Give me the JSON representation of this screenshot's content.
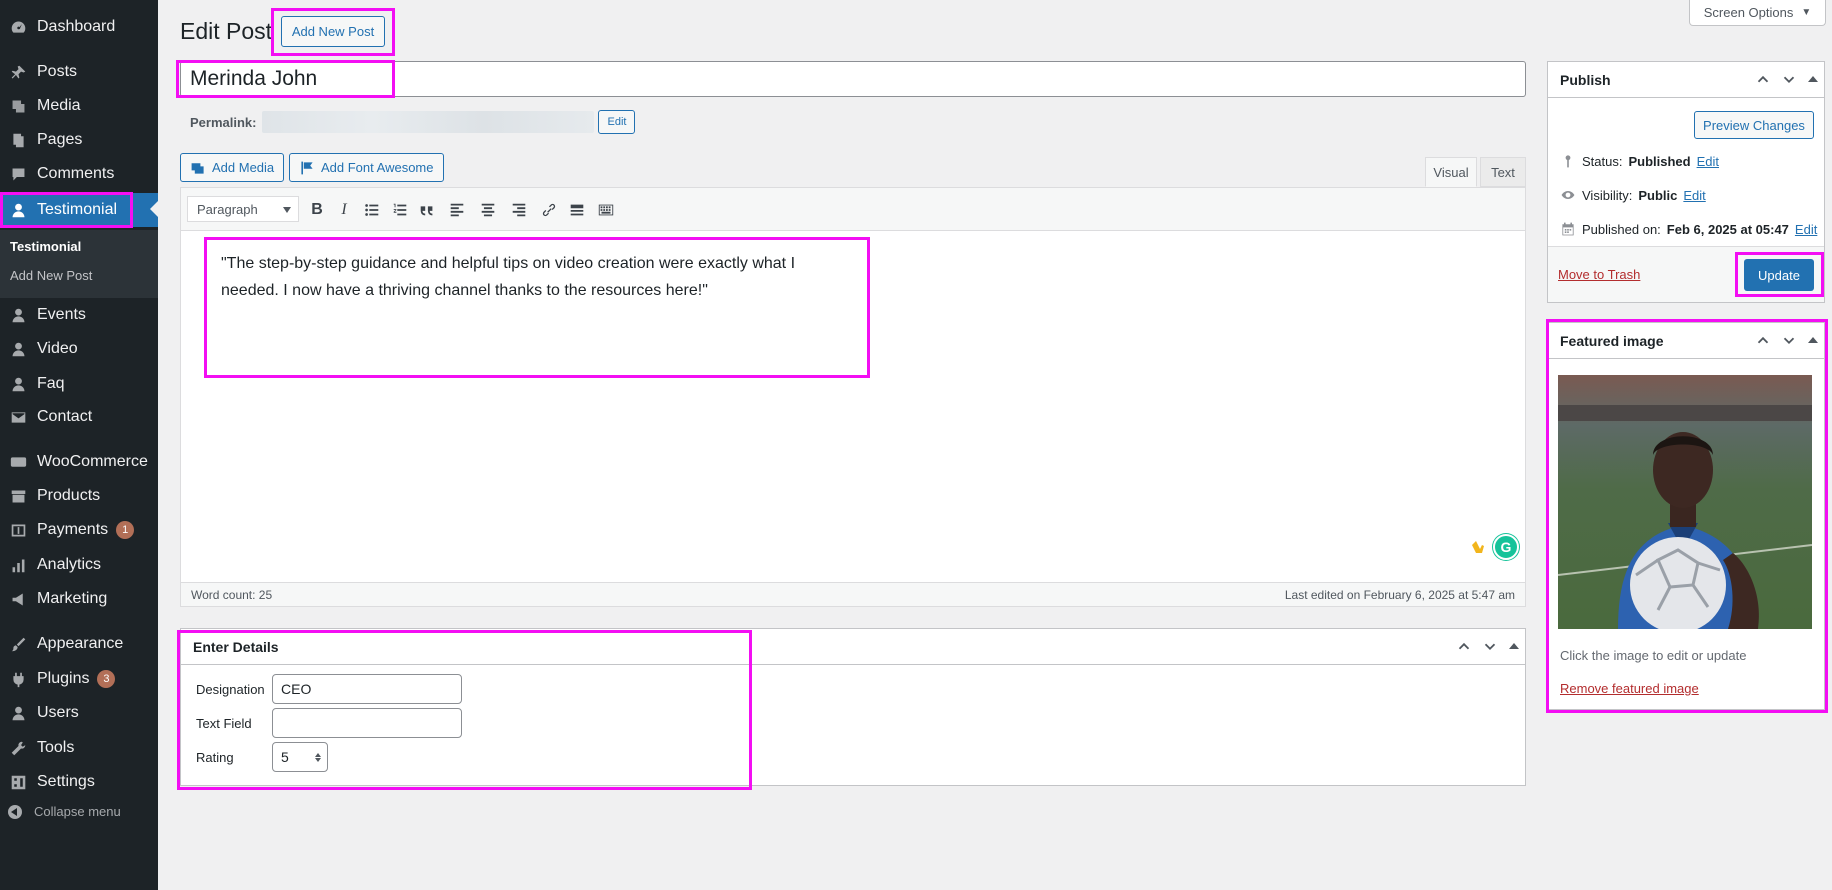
{
  "sidebar": {
    "items": [
      {
        "label": "Dashboard",
        "icon": "dashboard-icon"
      },
      {
        "label": "Posts",
        "icon": "pin-icon"
      },
      {
        "label": "Media",
        "icon": "media-icon"
      },
      {
        "label": "Pages",
        "icon": "page-icon"
      },
      {
        "label": "Comments",
        "icon": "comment-icon"
      },
      {
        "label": "Testimonial",
        "icon": "user-icon"
      },
      {
        "label": "Events",
        "icon": "user-icon"
      },
      {
        "label": "Video",
        "icon": "user-icon"
      },
      {
        "label": "Faq",
        "icon": "user-icon"
      },
      {
        "label": "Contact",
        "icon": "email-icon"
      },
      {
        "label": "WooCommerce",
        "icon": "woo-icon"
      },
      {
        "label": "Products",
        "icon": "archive-icon"
      },
      {
        "label": "Payments",
        "icon": "payments-icon",
        "badge": "1"
      },
      {
        "label": "Analytics",
        "icon": "chart-icon"
      },
      {
        "label": "Marketing",
        "icon": "megaphone-icon"
      },
      {
        "label": "Appearance",
        "icon": "brush-icon"
      },
      {
        "label": "Plugins",
        "icon": "plugin-icon",
        "badge": "3"
      },
      {
        "label": "Users",
        "icon": "users-icon"
      },
      {
        "label": "Tools",
        "icon": "wrench-icon"
      },
      {
        "label": "Settings",
        "icon": "settings-icon"
      }
    ],
    "submenu": {
      "current": "Testimonial",
      "add_new": "Add New Post"
    },
    "collapse": "Collapse menu",
    "accent": "#2271b1"
  },
  "header": {
    "title": "Edit Post",
    "add_new": "Add New Post",
    "screen_options": "Screen Options"
  },
  "post": {
    "title": "Merinda John",
    "permalink_label": "Permalink:",
    "permalink_edit": "Edit"
  },
  "editor": {
    "add_media": "Add Media",
    "add_font_awesome": "Add Font Awesome",
    "tab_visual": "Visual",
    "tab_text": "Text",
    "format": "Paragraph",
    "content_line1": "\"The step-by-step guidance and helpful tips on video creation were exactly what I",
    "content_line2": "needed. I now have a thriving channel thanks to the resources here!\"",
    "word_count": "Word count: 25",
    "last_edited": "Last edited on February 6, 2025 at 5:47 am"
  },
  "details": {
    "title": "Enter Details",
    "designation_label": "Designation",
    "designation_value": "CEO",
    "text_field_label": "Text Field",
    "text_field_value": "",
    "rating_label": "Rating",
    "rating_value": "5"
  },
  "publish": {
    "title": "Publish",
    "preview": "Preview Changes",
    "status_label": "Status:",
    "status_value": "Published",
    "visibility_label": "Visibility:",
    "visibility_value": "Public",
    "published_label": "Published on:",
    "published_value": "Feb 6, 2025 at 05:47",
    "edit": "Edit",
    "trash": "Move to Trash",
    "update": "Update"
  },
  "featured": {
    "title": "Featured image",
    "caption": "Click the image to edit or update",
    "remove": "Remove featured image"
  }
}
